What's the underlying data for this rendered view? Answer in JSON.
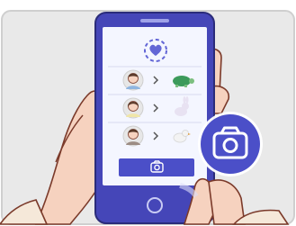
{
  "illustration": {
    "background_color": "#e9e9e9",
    "frame_color": "#cfcfcf",
    "phone_color": "#4546b8",
    "phone_screen_color": "#f4f6ff",
    "accent_color": "#4b4fc8",
    "heart_color": "#6366d6",
    "skin_color": "#f6d2bf",
    "skin_outline": "#7b3a2a",
    "sleeve_color": "#f5e8d9",
    "icons": {
      "top": "heart-icon",
      "rows": [
        {
          "avatar": "person-icon",
          "arrow": "chevron-right-icon",
          "pet": "turtle-icon"
        },
        {
          "avatar": "person-icon",
          "arrow": "chevron-right-icon",
          "pet": "rabbit-icon"
        },
        {
          "avatar": "person-icon",
          "arrow": "chevron-right-icon",
          "pet": "bird-icon"
        }
      ],
      "button": "camera-icon",
      "overlay": "camera-icon"
    }
  }
}
